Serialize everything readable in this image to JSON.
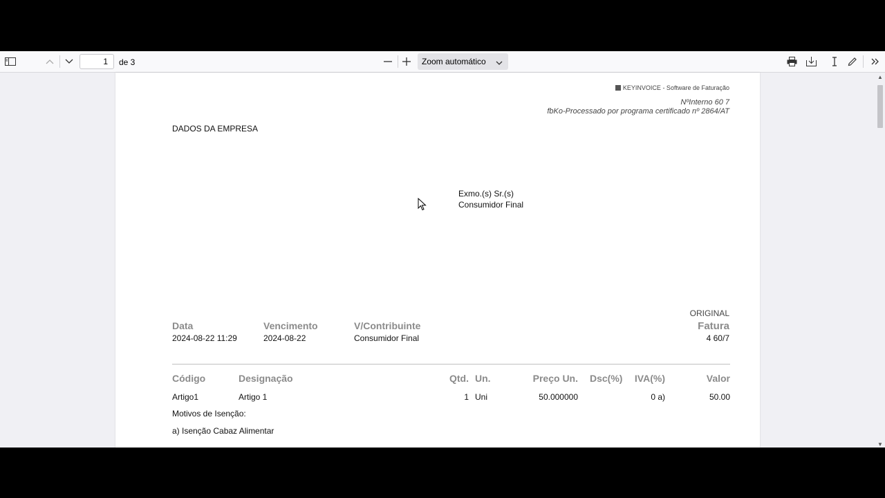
{
  "toolbar": {
    "current_page": "1",
    "page_of": "de 3",
    "zoom_label": "Zoom automático"
  },
  "document": {
    "brand": "KEYINVOICE - Software de Faturação",
    "internal_number": "NºInterno 60 7",
    "certified_note": "fbKo-Processado por programa certificado nº 2864/AT",
    "company_label": "DADOS DA EMPRESA",
    "recipient_label": "Exmo.(s) Sr.(s)",
    "recipient_name": "Consumidor Final",
    "original_label": "ORIGINAL",
    "doc_type": "Fatura",
    "doc_number": "4 60/7",
    "header_fields": {
      "data_label": "Data",
      "data_value": "2024-08-22 11:29",
      "vencimento_label": "Vencimento",
      "vencimento_value": "2024-08-22",
      "contribuinte_label": "V/Contribuinte",
      "contribuinte_value": "Consumidor Final"
    },
    "table": {
      "headers": {
        "codigo": "Código",
        "designacao": "Designação",
        "qtd": "Qtd.",
        "un": "Un.",
        "preco": "Preço Un.",
        "dsc": "Dsc(%)",
        "iva": "IVA(%)",
        "valor": "Valor"
      },
      "rows": [
        {
          "codigo": "Artigo1",
          "designacao": "Artigo 1",
          "qtd": "1",
          "un": "Uni",
          "preco": "50.000000",
          "dsc": "",
          "iva": "0 a)",
          "valor": "50.00"
        }
      ]
    },
    "exemption_title": "Motivos de Isenção:",
    "exemption_reason": "a) Isenção Cabaz Alimentar"
  }
}
